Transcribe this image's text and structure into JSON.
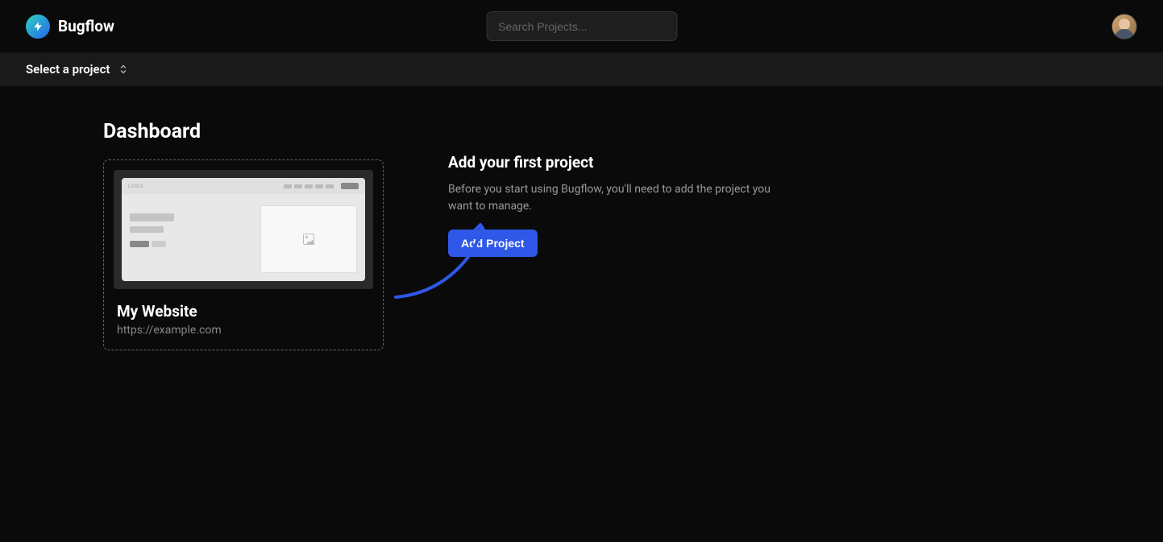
{
  "header": {
    "brand": "Bugflow",
    "search_placeholder": "Search Projects..."
  },
  "subheader": {
    "project_selector_label": "Select a project"
  },
  "dashboard": {
    "title": "Dashboard",
    "card": {
      "title": "My Website",
      "url": "https://example.com",
      "mock_logo_text": "LOGO"
    }
  },
  "cta": {
    "title": "Add your first project",
    "description": "Before you start using Bugflow, you'll need to add the project you want to manage.",
    "button_label": "Add Project"
  }
}
